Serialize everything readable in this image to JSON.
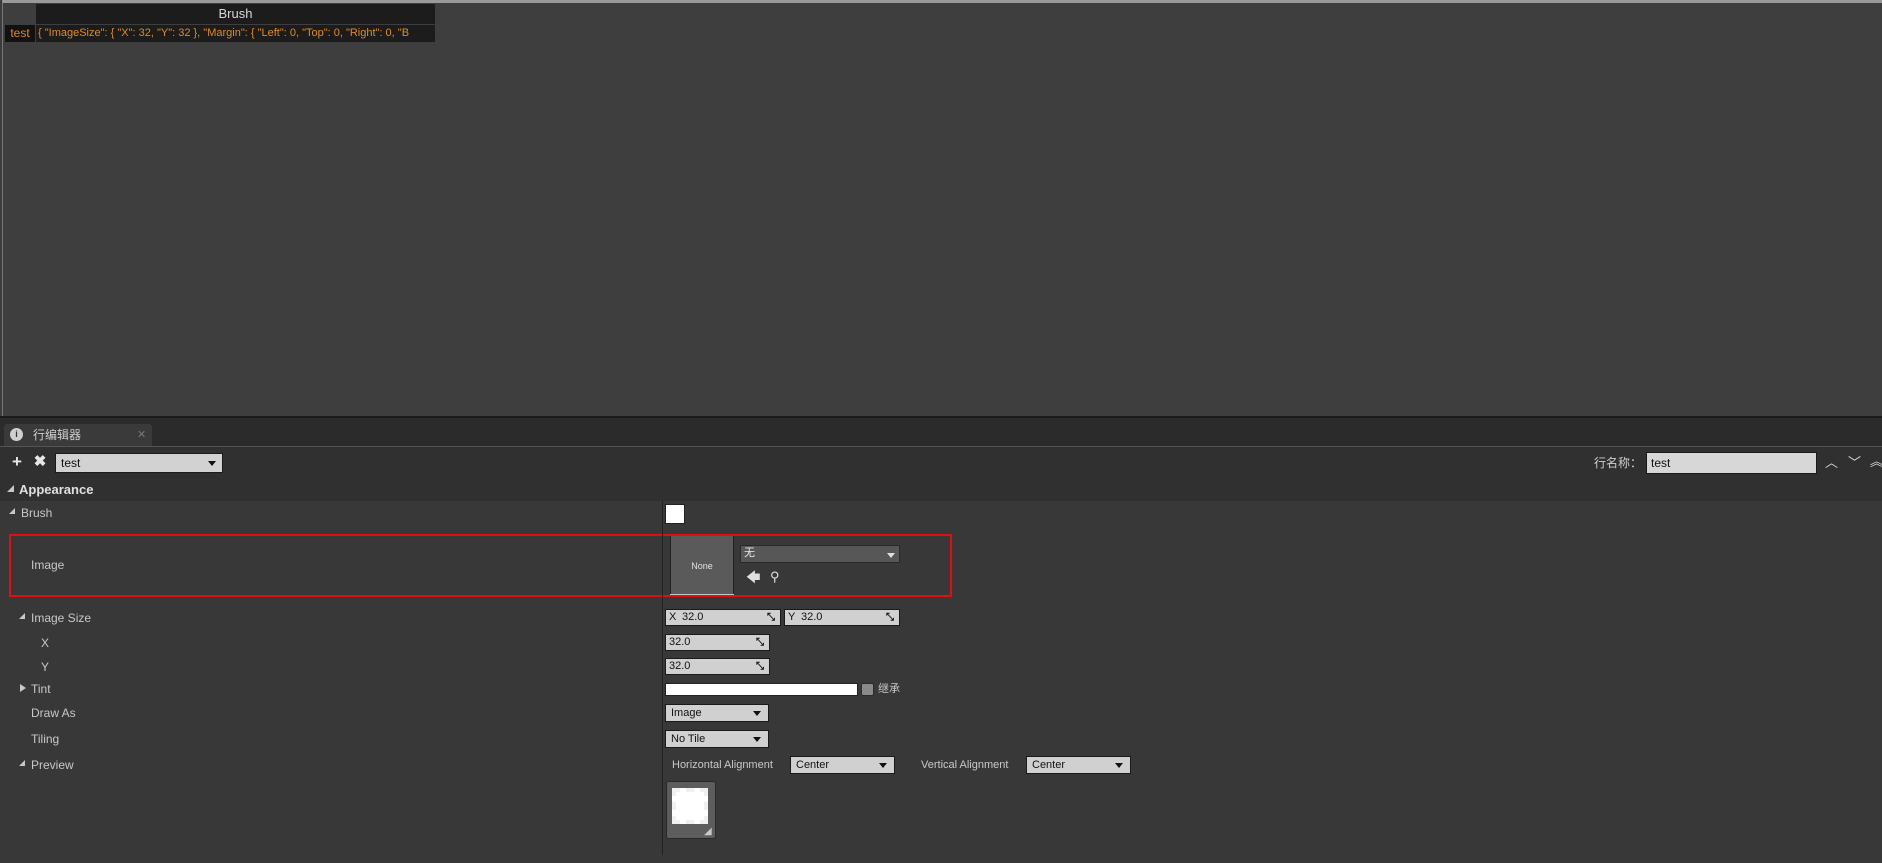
{
  "table": {
    "column_header": "Brush",
    "rows": [
      {
        "name": "test",
        "value": "{ \"ImageSize\": { \"X\": 32, \"Y\": 32 }, \"Margin\": { \"Left\": 0, \"Top\": 0, \"Right\": 0, \"B"
      }
    ]
  },
  "tab": {
    "label": "行编辑器",
    "icon": "row-editor-icon",
    "close_icon": "close-icon"
  },
  "toolbar": {
    "add_icon": "plus-icon",
    "remove_icon": "x-icon",
    "row_select_value": "test",
    "row_name_label": "行名称：",
    "row_name_value": "test"
  },
  "details": {
    "category": "Appearance",
    "properties": {
      "brush": "Brush",
      "image": "Image",
      "image_thumbnail_text": "None",
      "image_asset_value": "无",
      "image_size": "Image Size",
      "image_size_x_axis": "X",
      "image_size_x": "32.0",
      "image_size_y_axis": "Y",
      "image_size_y": "32.0",
      "x": "X",
      "x_value": "32.0",
      "y": "Y",
      "y_value": "32.0",
      "tint": "Tint",
      "tint_inherit_label": "继承",
      "tint_color": "#ffffff",
      "draw_as": "Draw As",
      "draw_as_value": "Image",
      "tiling": "Tiling",
      "tiling_value": "No Tile",
      "preview": "Preview",
      "horizontal_alignment_label": "Horizontal Alignment",
      "horizontal_alignment_value": "Center",
      "vertical_alignment_label": "Vertical Alignment",
      "vertical_alignment_value": "Center"
    }
  },
  "colors": {
    "background": "#3c3c3c",
    "row_text_accent": "#e38b1d",
    "highlight_border": "#e01010"
  }
}
